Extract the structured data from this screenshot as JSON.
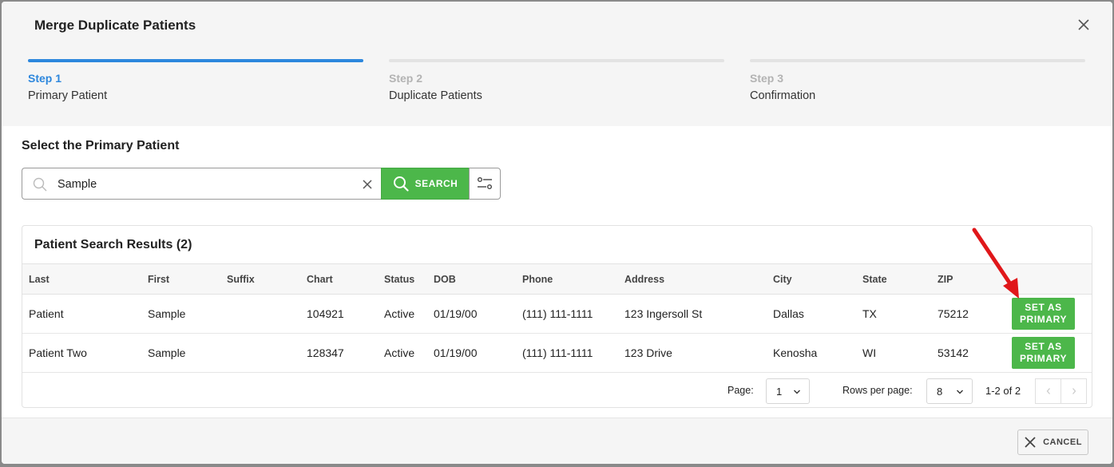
{
  "modal": {
    "title": "Merge Duplicate Patients",
    "close_icon": "close-icon"
  },
  "steps": [
    {
      "number": "Step 1",
      "name": "Primary Patient",
      "active": true
    },
    {
      "number": "Step 2",
      "name": "Duplicate Patients",
      "active": false
    },
    {
      "number": "Step 3",
      "name": "Confirmation",
      "active": false
    }
  ],
  "section_title": "Select the Primary Patient",
  "search": {
    "value": "Sample",
    "button_label": "SEARCH",
    "search_icon": "search-icon",
    "clear_icon": "clear-icon",
    "filter_icon": "filter-icon"
  },
  "results": {
    "title": "Patient Search Results (2)",
    "columns": [
      "Last",
      "First",
      "Suffix",
      "Chart",
      "Status",
      "DOB",
      "Phone",
      "Address",
      "City",
      "State",
      "ZIP"
    ],
    "rows": [
      {
        "last": "Patient",
        "first": "Sample",
        "suffix": "",
        "chart": "104921",
        "status": "Active",
        "dob": "01/19/00",
        "phone": "(111) 111-1111",
        "address": "123 Ingersoll St",
        "city": "Dallas",
        "state": "TX",
        "zip": "75212",
        "action": "SET AS PRIMARY"
      },
      {
        "last": "Patient Two",
        "first": "Sample",
        "suffix": "",
        "chart": "128347",
        "status": "Active",
        "dob": "01/19/00",
        "phone": "(111) 111-1111",
        "address": "123 Drive",
        "city": "Kenosha",
        "state": "WI",
        "zip": "53142",
        "action": "SET AS PRIMARY"
      }
    ]
  },
  "pagination": {
    "page_label": "Page:",
    "page_value": "1",
    "rows_label": "Rows per page:",
    "rows_value": "8",
    "range": "1-2 of 2",
    "prev_icon": "chevron-left-icon",
    "next_icon": "chevron-right-icon"
  },
  "footer": {
    "cancel_label": "CANCEL"
  },
  "colors": {
    "accent": "#2d87dd",
    "success": "#4cb74a",
    "annotation": "#e0171a"
  }
}
